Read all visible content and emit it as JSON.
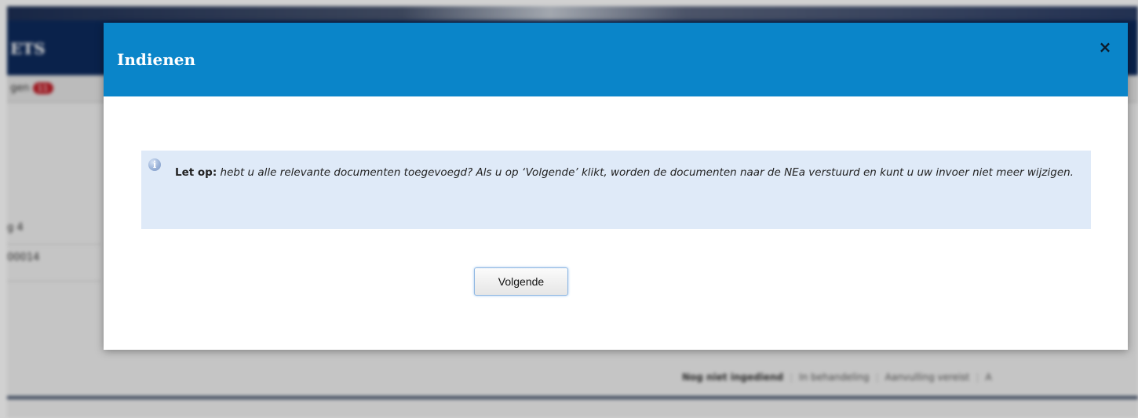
{
  "background": {
    "logo": "ETS",
    "subbar_text": "gen",
    "badge_count": "11",
    "field_label": "g 4",
    "field_value": "00014",
    "status_tabs": [
      "Nog niet ingediend",
      "In behandeling",
      "Aanvulling vereist",
      "A"
    ]
  },
  "modal": {
    "title": "Indienen",
    "close_glyph": "×",
    "notice": {
      "icon_glyph": "i",
      "label": "Let op:",
      "message": " hebt u alle relevante documenten toegevoegd? Als u op ‘Volgende’ klikt, worden de documenten naar de NEa verstuurd en kunt u uw invoer niet meer wijzigen."
    },
    "next_button_label": "Volgende"
  },
  "colors": {
    "header_blue": "#0a85c9",
    "notice_bg": "#dfeaf8",
    "badge_red": "#c0202a"
  }
}
